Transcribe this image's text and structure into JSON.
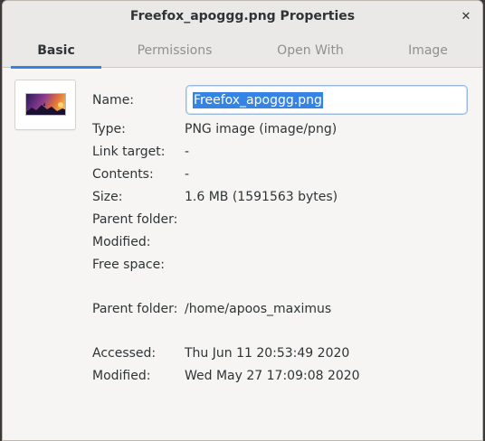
{
  "window": {
    "title": "Freefox_apoggg.png Properties",
    "close_glyph": "✕"
  },
  "tabs": [
    {
      "label": "Basic",
      "active": true
    },
    {
      "label": "Permissions",
      "active": false
    },
    {
      "label": "Open With",
      "active": false
    },
    {
      "label": "Image",
      "active": false
    }
  ],
  "file_icon": "image-thumbnail-icon",
  "fields": {
    "name": {
      "label": "Name:",
      "value": "Freefox_apoggg.png"
    },
    "type": {
      "label": "Type:",
      "value": "PNG image (image/png)"
    },
    "link_target": {
      "label": "Link target:",
      "value": "-"
    },
    "contents": {
      "label": "Contents:",
      "value": "-"
    },
    "size": {
      "label": "Size:",
      "value": "1.6 MB (1591563 bytes)"
    },
    "parent_folder_1": {
      "label": "Parent folder:",
      "value": ""
    },
    "modified_1": {
      "label": "Modified:",
      "value": ""
    },
    "free_space": {
      "label": "Free space:",
      "value": ""
    },
    "parent_folder_2": {
      "label": "Parent folder:",
      "value": "/home/apoos_maximus"
    },
    "accessed": {
      "label": "Accessed:",
      "value": "Thu Jun 11 20:53:49 2020"
    },
    "modified_2": {
      "label": "Modified:",
      "value": "Wed May 27 17:09:08 2020"
    }
  },
  "colors": {
    "accent": "#3584e4",
    "text": "#2e3436",
    "inactive_tab": "#8d9091"
  }
}
